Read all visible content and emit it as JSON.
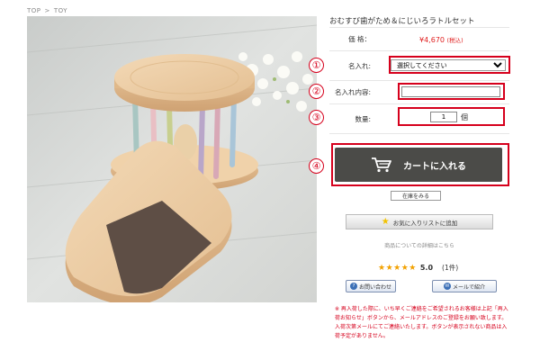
{
  "breadcrumb": {
    "home": "TOP",
    "separator": ">",
    "current": "TOY"
  },
  "product": {
    "title": "おむすび歯がため＆にじいろラトルセット",
    "price_label": "価 格：",
    "price": "¥4,670",
    "tax_note": "(税込)"
  },
  "form": {
    "name_label": "名入れ:",
    "name_select_value": "選択してください",
    "name_content_label": "名入れ内容:",
    "name_content_value": "",
    "qty_label": "数量:",
    "qty_value": "1",
    "qty_unit": "個"
  },
  "callouts": [
    "①",
    "②",
    "③",
    "④"
  ],
  "buttons": {
    "cart": "カートに入れる",
    "stock": "在庫をみる",
    "favorite": "お気に入りリストに追加",
    "inquiry": "お問い合わせ",
    "mail": "メールで紹介"
  },
  "detail_link": "商品についての詳細はこちら",
  "rating": {
    "stars": "★★★★★",
    "score": "5.0",
    "count": "(1件)"
  },
  "notice": "※ 再入荷した際に、いち早くご連絡をご希望されるお客様は上記「再入荷お知らせ」ボタンから、メールアドレスのご登録をお願い致します。入荷次第メールにてご連絡いたします。ボタンが表示されない商品は入荷予定がありません。",
  "colors": {
    "accent_red": "#d6001c",
    "price_red": "#e02020",
    "cart_bg": "#4b4b48",
    "star": "#f2a100"
  }
}
